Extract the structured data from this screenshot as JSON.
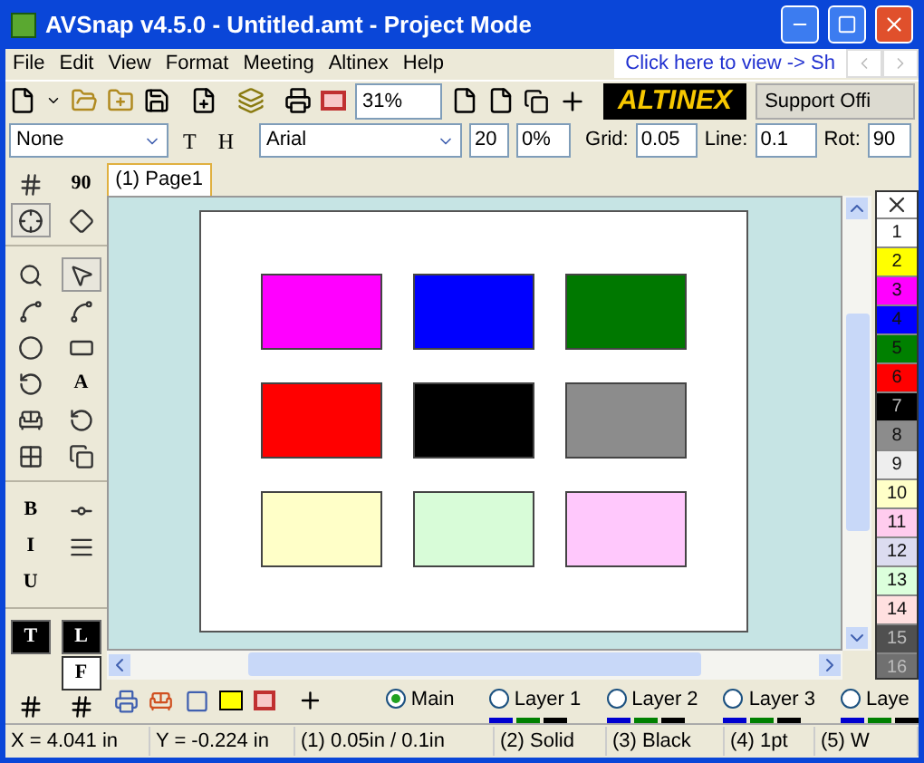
{
  "window": {
    "title": "AVSnap v4.5.0 - Untitled.amt  - Project Mode"
  },
  "menu": [
    "File",
    "Edit",
    "View",
    "Format",
    "Meeting",
    "Altinex",
    "Help"
  ],
  "banner": {
    "text": "Click here to view -> Sh"
  },
  "toolbar": {
    "zoom": "31%",
    "logo": "ALTINEX",
    "support": "Support Offi"
  },
  "format_bar": {
    "style": "None",
    "t_label": "T",
    "h_label": "H",
    "font": "Arial",
    "size": "20",
    "percent": "0%",
    "grid_label": "Grid:",
    "grid": "0.05",
    "line_label": "Line:",
    "line": "0.1",
    "rot_label": "Rot:",
    "rot": "90"
  },
  "left_tools": [
    {
      "kind": "icon",
      "selected": false
    },
    {
      "kind": "text",
      "label": "90",
      "selected": false
    },
    {
      "kind": "icon",
      "selected": true
    },
    {
      "kind": "icon",
      "selected": false
    },
    {
      "kind": "sep"
    },
    {
      "kind": "icon",
      "selected": false
    },
    {
      "kind": "icon",
      "selected": true
    },
    {
      "kind": "icon",
      "selected": false
    },
    {
      "kind": "icon",
      "selected": false
    },
    {
      "kind": "icon",
      "selected": false
    },
    {
      "kind": "icon",
      "selected": false
    },
    {
      "kind": "icon",
      "selected": false
    },
    {
      "kind": "text",
      "label": "A",
      "selected": false
    },
    {
      "kind": "icon",
      "selected": false
    },
    {
      "kind": "icon",
      "selected": false
    },
    {
      "kind": "icon",
      "selected": false
    },
    {
      "kind": "icon",
      "selected": false
    },
    {
      "kind": "sep"
    },
    {
      "kind": "text",
      "label": "B",
      "selected": false
    },
    {
      "kind": "icon",
      "selected": false
    },
    {
      "kind": "text",
      "label": "I",
      "selected": false
    },
    {
      "kind": "icon",
      "selected": false
    },
    {
      "kind": "text",
      "label": "U",
      "selected": false
    },
    {
      "kind": "blank"
    },
    {
      "kind": "sep"
    },
    {
      "kind": "text",
      "label": "T",
      "selected": true
    },
    {
      "kind": "text",
      "label": "L",
      "selected": true
    },
    {
      "kind": "blank"
    },
    {
      "kind": "text",
      "label": "F",
      "selected": false
    }
  ],
  "tabs": [
    {
      "label": "(1) Page1",
      "selected": true
    }
  ],
  "shapes": [
    {
      "color": "#ff00ff"
    },
    {
      "color": "#0000ff"
    },
    {
      "color": "#007800"
    },
    {
      "color": "#ff0000"
    },
    {
      "color": "#000000"
    },
    {
      "color": "#8c8c8c"
    },
    {
      "color": "#ffffc8"
    },
    {
      "color": "#d8fcd8"
    },
    {
      "color": "#ffc8fc"
    }
  ],
  "palette": [
    {
      "kind": "none"
    },
    {
      "label": "1",
      "color": "#ffffff"
    },
    {
      "label": "2",
      "color": "#ffff00"
    },
    {
      "label": "3",
      "color": "#ff00ff"
    },
    {
      "label": "4",
      "color": "#0000ff"
    },
    {
      "label": "5",
      "color": "#008000"
    },
    {
      "label": "6",
      "color": "#ff0000"
    },
    {
      "label": "7",
      "color": "#000000"
    },
    {
      "label": "8",
      "color": "#8c8c8c"
    },
    {
      "label": "9",
      "color": "#eeeeee"
    },
    {
      "label": "10",
      "color": "#ffffc8"
    },
    {
      "label": "11",
      "color": "#ffccee"
    },
    {
      "label": "12",
      "color": "#dcdcf0"
    },
    {
      "label": "13",
      "color": "#dcffdc"
    },
    {
      "label": "14",
      "color": "#ffe0e0"
    },
    {
      "label": "15",
      "color": "#505050"
    },
    {
      "label": "16",
      "color": "#707070"
    }
  ],
  "layers": [
    {
      "label": "Main",
      "selected": true
    },
    {
      "label": "Layer 1",
      "selected": false
    },
    {
      "label": "Layer 2",
      "selected": false
    },
    {
      "label": "Layer 3",
      "selected": false
    },
    {
      "label": "Laye",
      "selected": false
    }
  ],
  "status_bar": [
    "X = 4.041 in",
    "Y = -0.224 in",
    "(1) 0.05in / 0.1in",
    "(2) Solid",
    "(3) Black",
    "(4) 1pt",
    "(5) W"
  ]
}
